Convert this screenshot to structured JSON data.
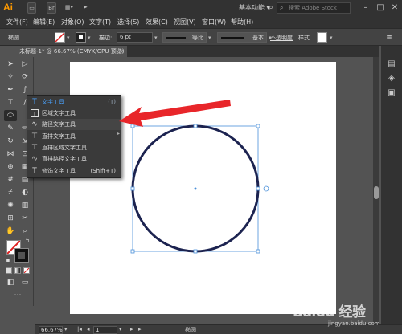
{
  "titlebar": {
    "app_logo": "Ai",
    "bridge_label": "Br",
    "workspace": "基本功能",
    "stock_placeholder": "搜索 Adobe Stock",
    "icons": [
      "layout-icon",
      "send-icon",
      "search-icon",
      "minimize-icon",
      "maximize-icon",
      "close-icon"
    ]
  },
  "menubar": {
    "items": [
      "文件(F)",
      "编辑(E)",
      "对象(O)",
      "文字(T)",
      "选择(S)",
      "效果(C)",
      "视图(V)",
      "窗口(W)",
      "帮助(H)"
    ]
  },
  "controlbar": {
    "selection_label": "椭圆",
    "stroke_label": "描边:",
    "stroke_weight": "6 pt",
    "profile_label": "等比",
    "brush_label": "基本",
    "opacity_label": "不透明度",
    "style_label": "样式"
  },
  "document_tab": {
    "title": "未标题-1* @ 66.67% (CMYK/GPU 预览)",
    "close": "×"
  },
  "flyout": {
    "items": [
      {
        "icon": "T",
        "label": "文字工具",
        "shortcut": "(T)"
      },
      {
        "icon": "T",
        "label": "区域文字工具",
        "shortcut": ""
      },
      {
        "icon": "∿",
        "label": "路径文字工具",
        "shortcut": ""
      },
      {
        "icon": "⊤",
        "label": "直排文字工具",
        "shortcut": ""
      },
      {
        "icon": "⊤",
        "label": "直排区域文字工具",
        "shortcut": ""
      },
      {
        "icon": "∿",
        "label": "直排路径文字工具",
        "shortcut": ""
      },
      {
        "icon": "T",
        "label": "修饰文字工具",
        "shortcut": "(Shift+T)"
      }
    ]
  },
  "statusbar": {
    "zoom": "66.67%",
    "artboard_number": "1",
    "tool_name": "椭圆"
  },
  "watermark": {
    "main": "Baidu 经验",
    "sub": "jingyan.baidu.com"
  },
  "colors": {
    "circle_stroke": "#1c2350",
    "arrow": "#e8262a",
    "selection": "#4a90d9",
    "highlight": "#4aa3ff"
  }
}
